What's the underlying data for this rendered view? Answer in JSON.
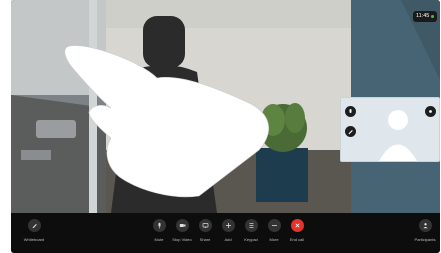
{
  "status": {
    "time": "11:45"
  },
  "controls": {
    "left": {
      "label": "Whiteboard",
      "icon": "pen-icon"
    },
    "center": [
      {
        "label": "Mute",
        "icon": "microphone-icon"
      },
      {
        "label": "Stop Video",
        "icon": "video-camera-icon"
      },
      {
        "label": "Share",
        "icon": "share-screen-icon"
      },
      {
        "label": "Add",
        "icon": "plus-icon"
      },
      {
        "label": "Keypad",
        "icon": "keypad-icon"
      },
      {
        "label": "More",
        "icon": "more-icon"
      },
      {
        "label": "End call",
        "icon": "hang-up-icon"
      }
    ],
    "right": {
      "label": "Participants",
      "icon": "participants-icon"
    }
  },
  "self_view": {
    "icons": [
      "mute-icon",
      "expand-icon",
      "edit-icon"
    ]
  },
  "colors": {
    "end_call": "#e2342a",
    "status_dot": "#3fc24b",
    "control_bar": "#0d0d0d"
  }
}
